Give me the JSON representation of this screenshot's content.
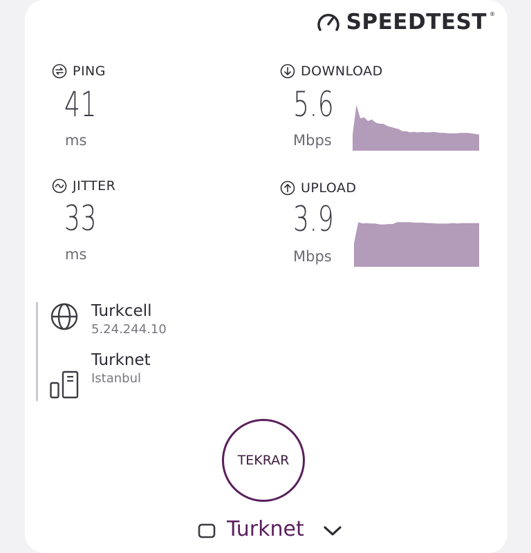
{
  "brand": {
    "name": "SPEEDTEST",
    "mark": "®"
  },
  "metrics": {
    "ping": {
      "label": "PING",
      "value": "41",
      "unit": "ms"
    },
    "jitter": {
      "label": "JITTER",
      "value": "33",
      "unit": "ms"
    },
    "download": {
      "label": "DOWNLOAD",
      "value": "5.6",
      "unit": "Mbps",
      "graph": [
        0.3,
        0.85,
        0.6,
        0.62,
        0.55,
        0.58,
        0.52,
        0.5,
        0.5,
        0.46,
        0.44,
        0.42,
        0.4,
        0.36,
        0.36,
        0.34,
        0.35,
        0.34,
        0.35,
        0.34,
        0.34,
        0.35,
        0.34,
        0.33,
        0.33,
        0.32,
        0.32,
        0.32,
        0.33,
        0.33,
        0.33,
        0.32,
        0.31,
        0.3
      ]
    },
    "upload": {
      "label": "UPLOAD",
      "value": "3.9",
      "unit": "Mbps",
      "graph": [
        0.5,
        0.95,
        0.92,
        0.93,
        0.92,
        0.92,
        0.9,
        0.9,
        0.91,
        0.91,
        0.95,
        0.95,
        0.95,
        0.95,
        0.94,
        0.94,
        0.94,
        0.93,
        0.93,
        0.92,
        0.92,
        0.92,
        0.92,
        0.93,
        0.92,
        0.93,
        0.93,
        0.93,
        0.93,
        0.93
      ]
    }
  },
  "connection": {
    "isp": {
      "name": "Turkcell",
      "ip": "5.24.244.10",
      "icon": "globe-icon"
    },
    "server": {
      "name": "Turknet",
      "location": "Istanbul",
      "icon": "server-icon"
    }
  },
  "actions": {
    "again_label": "TEKRAR"
  },
  "bottom": {
    "provider": "Turknet"
  },
  "colors": {
    "graph": "#b39bba",
    "accent": "#5a1f5c"
  }
}
